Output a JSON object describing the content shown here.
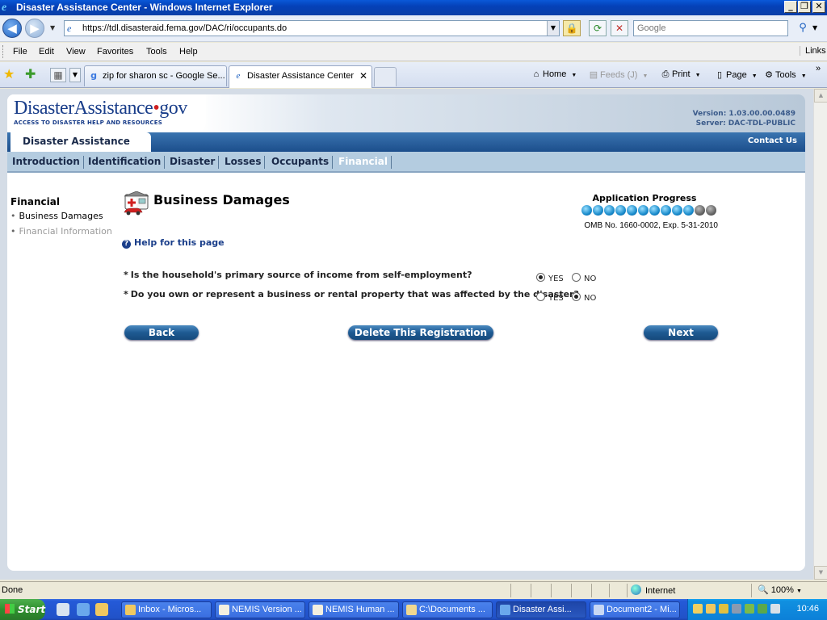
{
  "window": {
    "title": "Disaster Assistance Center - Windows Internet Explorer",
    "min_glyph": "_",
    "max_glyph": "❐",
    "close_glyph": "✕"
  },
  "addressbar": {
    "url": "https://tdl.disasteraid.fema.gov/DAC/ri/occupants.do",
    "search_placeholder": "Google"
  },
  "menubar": {
    "items": [
      "File",
      "Edit",
      "View",
      "Favorites",
      "Tools",
      "Help"
    ],
    "links": "Links"
  },
  "tabs": {
    "items": [
      {
        "label": "zip for sharon sc - Google Se...",
        "icon": "google-icon"
      },
      {
        "label": "Disaster Assistance Center",
        "icon": "ie-page-icon"
      }
    ],
    "close_glyph": "✕",
    "commands": {
      "home": "Home",
      "feeds": "Feeds (J)",
      "print": "Print",
      "page": "Page",
      "tools": "Tools"
    }
  },
  "site": {
    "logo": {
      "disaster": "Disaster",
      "assistance": "Assistance",
      "gov": "gov",
      "tagline": "ACCESS TO DISASTER HELP AND RESOURCES"
    },
    "version": "Version: 1.03.00.00.0489",
    "server": "Server: DAC-TDL-PUBLIC",
    "section_title": "Disaster Assistance",
    "contact": "Contact Us",
    "nav": [
      "Introduction",
      "Identification",
      "Disaster",
      "Losses",
      "Occupants",
      "Financial"
    ],
    "current_nav": "Financial"
  },
  "sidebar": {
    "title": "Financial",
    "items": [
      {
        "label": "Business Damages",
        "state": "current"
      },
      {
        "label": "Financial Information",
        "state": "disabled"
      }
    ]
  },
  "main": {
    "title": "Business Damages",
    "progress": {
      "label": "Application Progress",
      "completed_steps": 10,
      "total_steps": 12
    },
    "omb": "OMB No. 1660-0002, Exp. 5-31-2010",
    "help": "Help for this page",
    "questions": [
      {
        "text": "Is the household's primary source of income from self-employment?",
        "required_marker": "*",
        "answer": "YES"
      },
      {
        "text": "Do you own or represent a business or rental property that was affected by the disaster?",
        "required_marker": "*",
        "answer": "NO"
      }
    ],
    "yes_label": "YES",
    "no_label": "NO",
    "buttons": {
      "back": "Back",
      "delete": "Delete This Registration",
      "next": "Next"
    }
  },
  "status": {
    "text": "Done",
    "zone": "Internet",
    "zoom": "100%"
  },
  "taskbar": {
    "start": "Start",
    "items": [
      {
        "label": "Inbox - Micros...",
        "active": false
      },
      {
        "label": "NEMIS Version ...",
        "active": false
      },
      {
        "label": "NEMIS Human ...",
        "active": false
      },
      {
        "label": "C:\\Documents ...",
        "active": false
      },
      {
        "label": "Disaster Assi...",
        "active": true
      },
      {
        "label": "Document2 - Mi...",
        "active": false
      }
    ],
    "clock": "10:46"
  },
  "colors": {
    "brand_blue": "#1a3e8a",
    "nav_bar": "#b4cce0",
    "progress_done": "#1a8ccc",
    "progress_todo": "#666666"
  }
}
